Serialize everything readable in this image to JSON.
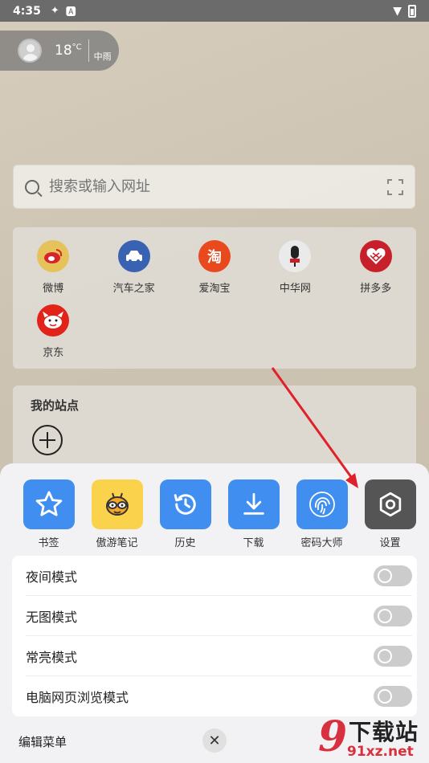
{
  "status": {
    "time": "4:35"
  },
  "weather": {
    "temperature": "18",
    "unit": "°C",
    "condition": "中雨"
  },
  "search": {
    "placeholder": "搜索或输入网址"
  },
  "shortcuts": [
    {
      "label": "微博",
      "icon": "weibo-icon",
      "color": "#e6c35a"
    },
    {
      "label": "汽车之家",
      "icon": "car-icon",
      "color": "#3a62b2"
    },
    {
      "label": "爱淘宝",
      "icon": "taobao-icon",
      "color": "#e8491d",
      "glyph": "淘"
    },
    {
      "label": "中华网",
      "icon": "microphone-icon",
      "color": "#eaeaea"
    },
    {
      "label": "拼多多",
      "icon": "pinduoduo-icon",
      "color": "#c8202a"
    },
    {
      "label": "京东",
      "icon": "jd-icon",
      "color": "#e2231a"
    }
  ],
  "my_sites": {
    "title": "我的站点"
  },
  "menu": {
    "quick": [
      {
        "label": "书签",
        "icon": "star-icon",
        "color": "#3f8ef0"
      },
      {
        "label": "傲游笔记",
        "icon": "bee-icon",
        "color": "#fbd24b"
      },
      {
        "label": "历史",
        "icon": "history-icon",
        "color": "#3f8ef0"
      },
      {
        "label": "下载",
        "icon": "download-icon",
        "color": "#3f8ef0"
      },
      {
        "label": "密码大师",
        "icon": "fingerprint-icon",
        "color": "#3f8ef0"
      },
      {
        "label": "设置",
        "icon": "gear-icon",
        "color": "#555555"
      }
    ],
    "toggles": [
      {
        "label": "夜间模式",
        "on": false
      },
      {
        "label": "无图模式",
        "on": false
      },
      {
        "label": "常亮模式",
        "on": false
      },
      {
        "label": "电脑网页浏览模式",
        "on": false
      }
    ],
    "edit_label": "编辑菜单"
  },
  "watermark": {
    "logo": "9",
    "top_text": "下载站",
    "bottom_text": "91xz.net"
  }
}
